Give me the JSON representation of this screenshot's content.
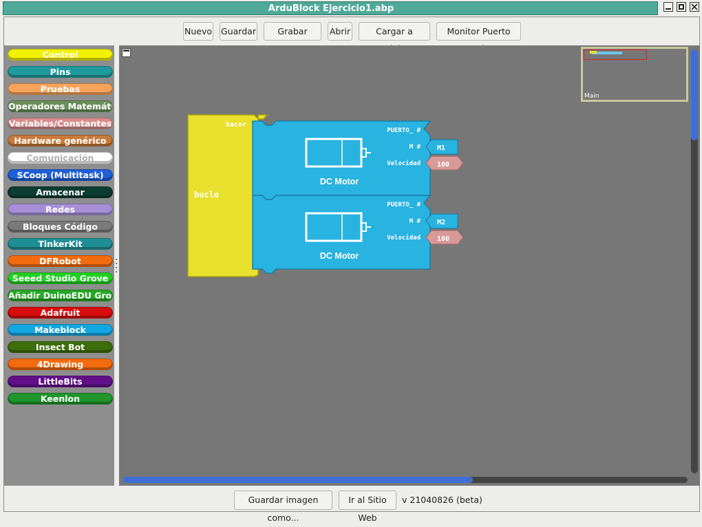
{
  "window": {
    "title": "ArduBlock Ejercicio1.abp",
    "title_color": "#4fa999"
  },
  "toolbar": {
    "buttons": [
      "Nuevo",
      "Guardar",
      "Grabar Como",
      "Abrir",
      "Cargar a Arduino",
      "Monitor Puerto Serie"
    ]
  },
  "palette": {
    "categories": [
      {
        "label": "Control",
        "color": "#f2f200"
      },
      {
        "label": "Pins",
        "color": "#1f9a9e"
      },
      {
        "label": "Pruebas",
        "color": "#f7a25a"
      },
      {
        "label": "Operadores Matemáticos",
        "color": "#6b8e5a"
      },
      {
        "label": "Variables/Constantes",
        "color": "#d98c8c"
      },
      {
        "label": "Hardware genérico",
        "color": "#c87a3a"
      },
      {
        "label": "Comunicación",
        "color": "#ffffff"
      },
      {
        "label": "SCoop (Multitask)",
        "color": "#1f5fd8"
      },
      {
        "label": "Amacenar",
        "color": "#0b3d33"
      },
      {
        "label": "Redes",
        "color": "#a78fd8"
      },
      {
        "label": "Bloques Código",
        "color": "#7a7a7a"
      },
      {
        "label": "TinkerKit",
        "color": "#1f8f95"
      },
      {
        "label": "DFRobot",
        "color": "#f26b0f"
      },
      {
        "label": "Seeed Studio Grove",
        "color": "#20d020"
      },
      {
        "label": "Añadir DuinoEDU Grove",
        "color": "#27a827"
      },
      {
        "label": "Adafruit",
        "color": "#d80c0c"
      },
      {
        "label": "Makeblock",
        "color": "#12a7e0"
      },
      {
        "label": "Insect Bot",
        "color": "#3d6e0c"
      },
      {
        "label": "4Drawing",
        "color": "#f26b0f"
      },
      {
        "label": "LittleBits",
        "color": "#62108a"
      },
      {
        "label": "Keenlon",
        "color": "#20962c"
      }
    ]
  },
  "workspace": {
    "loop_block": {
      "label": "bucle",
      "do_label": "hacer",
      "color": "#e8e02c"
    },
    "motor_blocks": [
      {
        "title": "DC Motor",
        "port_label": "PUERTO_ #",
        "m_label": "M #",
        "m_value": "M1",
        "speed_label": "Velocidad",
        "speed_value": "100"
      },
      {
        "title": "DC Motor",
        "port_label": "PUERTO_ #",
        "m_label": "M #",
        "m_value": "M2",
        "speed_label": "Velocidad",
        "speed_value": "100"
      }
    ],
    "motor_color": "#29b3e0",
    "speed_color": "#d79a98",
    "minimap_label": "Main"
  },
  "bottom": {
    "save_image_label": "Guardar imagen como...",
    "website_label": "Ir al Sitio Web",
    "version": "v 21040826 (beta)"
  }
}
